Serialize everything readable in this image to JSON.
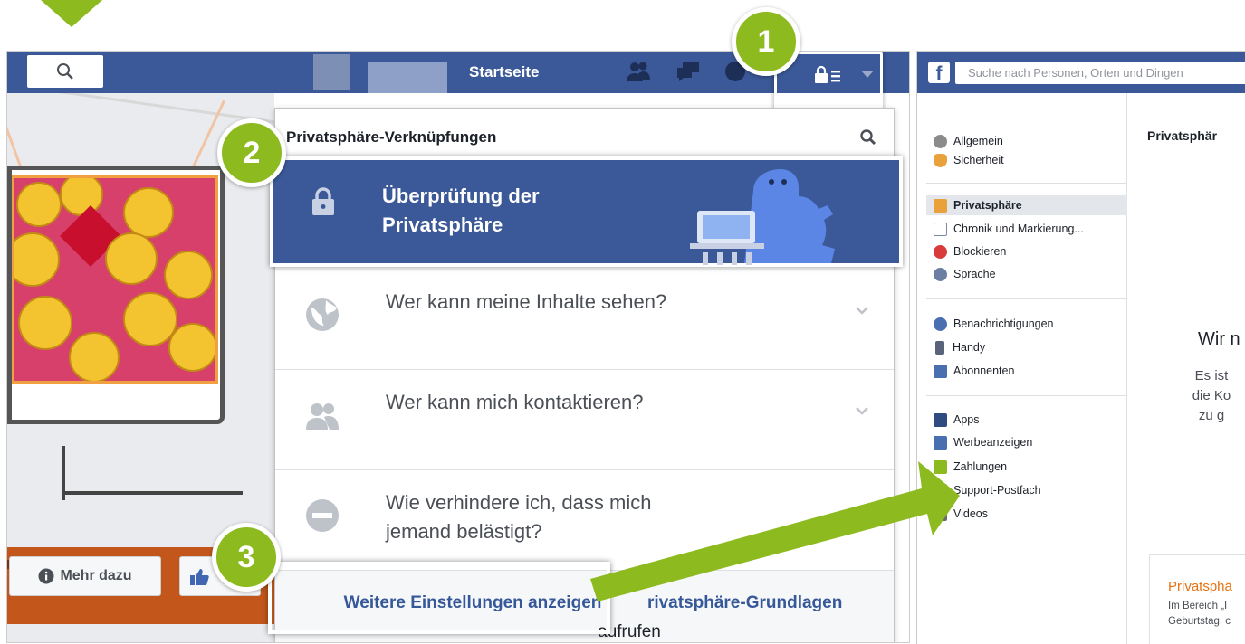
{
  "left": {
    "nav": {
      "home": "Startseite"
    },
    "dropdown": {
      "header": "Privatsphäre-Verknüpfungen",
      "checkup_title": "Überprüfung der Privatsphäre",
      "items": [
        {
          "label": "Wer kann meine Inhalte sehen?",
          "icon": "globe-icon"
        },
        {
          "label": "Wer kann mich kontaktieren?",
          "icon": "people-icon"
        },
        {
          "label": "Wie verhindere ich, dass mich jemand belästigt?",
          "icon": "block-icon"
        }
      ],
      "footer_link": "Weitere Einstellungen anzeigen",
      "footer_link_2": "rivatsphäre-Grundlagen",
      "footer_link_3": "aufrufen"
    },
    "page": {
      "more_button": "Mehr dazu"
    }
  },
  "badges": [
    "1",
    "2",
    "3"
  ],
  "right": {
    "search_placeholder": "Suche nach Personen, Orten und Dingen",
    "sidebar": {
      "group1": [
        {
          "label": "Allgemein",
          "icon": "gears-icon",
          "color": "#8b8b8b"
        },
        {
          "label": "Sicherheit",
          "icon": "shield-icon",
          "color": "#e9a23b"
        }
      ],
      "group2": [
        {
          "label": "Privatsphäre",
          "icon": "lock-icon",
          "color": "#e9a23b",
          "active": true
        },
        {
          "label": "Chronik und Markierung...",
          "icon": "timeline-icon",
          "color": "#7a8aa6"
        },
        {
          "label": "Blockieren",
          "icon": "block-icon",
          "color": "#d93a3a"
        },
        {
          "label": "Sprache",
          "icon": "globe-icon",
          "color": "#6b7ea3"
        }
      ],
      "group3": [
        {
          "label": "Benachrichtigungen",
          "icon": "globe-notification-icon",
          "color": "#4a6fb0"
        },
        {
          "label": "Handy",
          "icon": "phone-icon",
          "color": "#59647a"
        },
        {
          "label": "Abonnenten",
          "icon": "rss-icon",
          "color": "#4a6fb0"
        }
      ],
      "group4": [
        {
          "label": "Apps",
          "icon": "apps-icon",
          "color": "#2f4b80"
        },
        {
          "label": "Werbeanzeigen",
          "icon": "ads-icon",
          "color": "#4a6fb0"
        },
        {
          "label": "Zahlungen",
          "icon": "payments-icon",
          "color": "#8dba1f"
        },
        {
          "label": "Support-Postfach",
          "icon": "support-icon",
          "color": "#8dba1f"
        },
        {
          "label": "Videos",
          "icon": "film-icon",
          "color": "#6b6b6b"
        }
      ]
    },
    "title": "Privatsphär",
    "wir": "Wir n",
    "body": [
      "Es ist",
      "die Ko",
      "zu g"
    ],
    "card": {
      "heading": "Privatsphä",
      "text1": "Im Bereich „I",
      "text2": "Geburtstag, c"
    }
  },
  "colors": {
    "facebook_blue": "#3b5998",
    "badge_green": "#8dba1f",
    "link_blue": "#365899"
  }
}
